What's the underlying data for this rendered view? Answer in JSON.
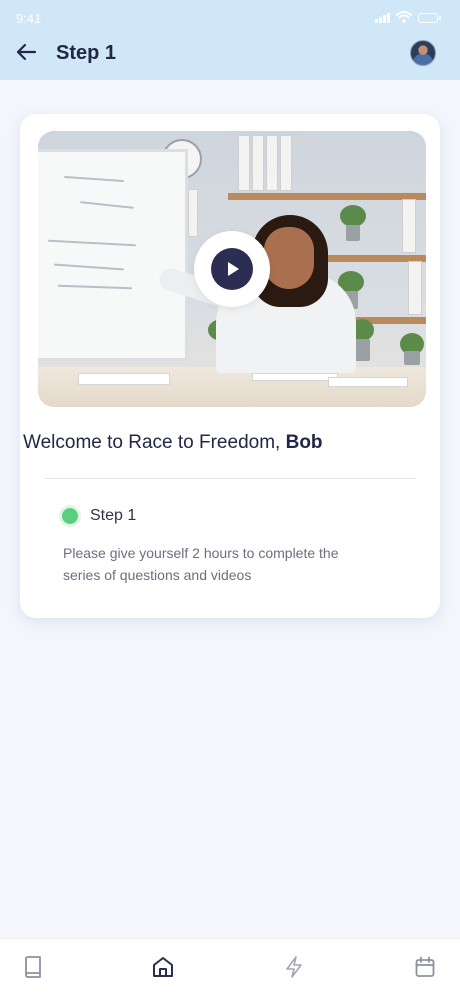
{
  "status_bar": {
    "time": "9:41"
  },
  "header": {
    "title": "Step 1",
    "back_icon": "arrow-left-icon",
    "avatar": "user-avatar"
  },
  "card": {
    "video": {
      "play_icon": "play-icon"
    },
    "welcome_prefix": "Welcome to Race to Freedom, ",
    "welcome_name": "Bob",
    "step": {
      "label": "Step 1",
      "status_color": "#5ccf7f",
      "description": "Please give yourself 2 hours to complete the series of questions and videos"
    }
  },
  "bottom_nav": {
    "items": [
      {
        "icon": "book-icon",
        "active": false
      },
      {
        "icon": "home-icon",
        "active": true
      },
      {
        "icon": "lightning-icon",
        "active": false
      },
      {
        "icon": "calendar-icon",
        "active": false
      }
    ]
  },
  "colors": {
    "header_bg": "#cfe7f7",
    "accent_dark": "#2b2d52",
    "page_bg": "#f4f6fc"
  }
}
